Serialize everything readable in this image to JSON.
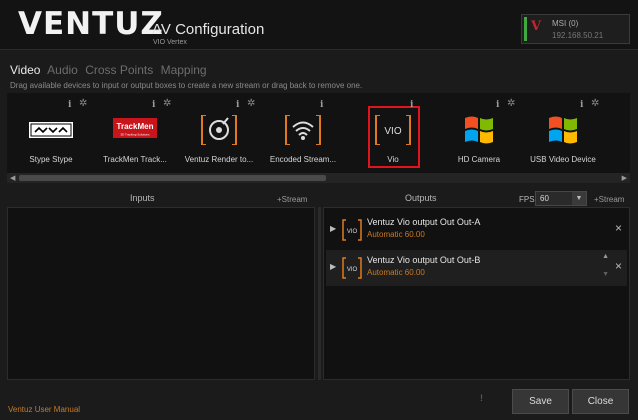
{
  "header": {
    "logo": "VENTUZ",
    "title": "AV Configuration",
    "subtitle": "VIO Vertex",
    "machine": {
      "name": "MSI",
      "count": "(0)",
      "ip": "192.168.50.21"
    }
  },
  "tabs": [
    {
      "label": "Video",
      "active": true
    },
    {
      "label": "Audio",
      "active": false
    },
    {
      "label": "Cross Points",
      "active": false
    },
    {
      "label": "Mapping",
      "active": false
    }
  ],
  "hint": "Drag available devices to input or output boxes to create a new stream or drag back to remove one.",
  "devices": [
    {
      "label": "Stype Stype",
      "icon": "stype-logo-icon"
    },
    {
      "label": "TrackMen Track...",
      "icon": "trackmen-logo-icon",
      "logo_text": "TrackMen",
      "logo_sub": "3D Tracking Solutions"
    },
    {
      "label": "Ventuz Render to...",
      "icon": "render-target-icon"
    },
    {
      "label": "Encoded Stream...",
      "icon": "wifi-stream-icon"
    },
    {
      "label": "Vio",
      "icon": "vio-device-icon",
      "selected": true,
      "icon_text": "VIO"
    },
    {
      "label": "HD Camera",
      "icon": "windows-logo-icon"
    },
    {
      "label": "USB Video Device",
      "icon": "windows-logo-icon"
    }
  ],
  "inputs": {
    "title": "Inputs",
    "add_stream": "+Stream"
  },
  "outputs": {
    "title": "Outputs",
    "add_stream": "+Stream",
    "fps_label": "FPS",
    "fps_value": "60",
    "items": [
      {
        "name": "Ventuz Vio output Out Out-A",
        "mode": "Automatic 60.00",
        "icon_text": "VIO"
      },
      {
        "name": "Ventuz Vio output Out Out-B",
        "mode": "Automatic 60.00",
        "icon_text": "VIO"
      }
    ]
  },
  "footer": {
    "manual_link": "Ventuz User Manual",
    "save": "Save",
    "close": "Close"
  },
  "colors": {
    "accent_orange": "#c97a23",
    "selection_red": "#e0141c",
    "online_green": "#3faa3f"
  }
}
